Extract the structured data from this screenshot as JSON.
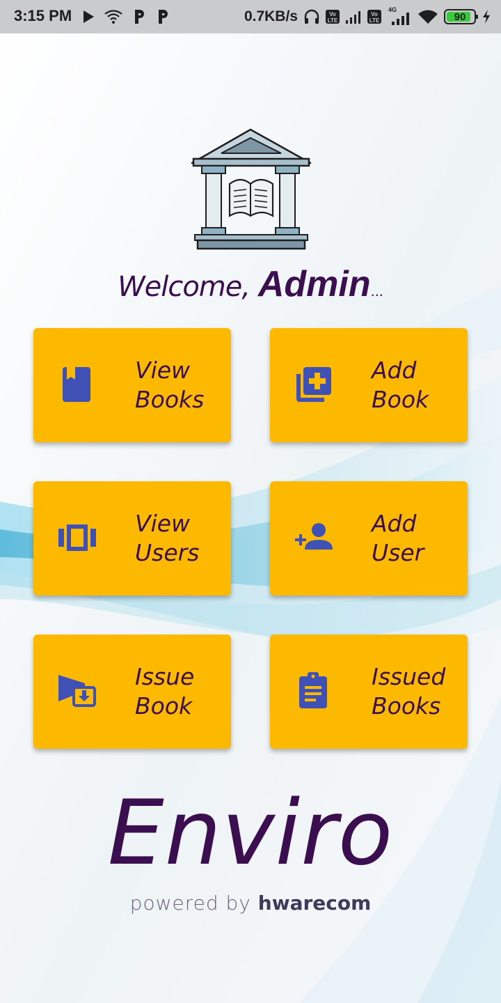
{
  "status_bar": {
    "time": "3:15 PM",
    "net_speed": "0.7KB/s",
    "lte1": "Vo LTE",
    "lte2": "Vo LTE",
    "network_type": "4G",
    "battery_level": "90",
    "battery_fraction": 0.9,
    "icons": [
      "play-icon",
      "wifi-icon",
      "p-icon",
      "p-icon",
      "headphones-icon",
      "signal-icon",
      "signal-icon",
      "wifi-icon",
      "battery-icon",
      "charging-icon"
    ]
  },
  "header": {
    "logo": "library-building-icon",
    "welcome_prefix": "Welcome, ",
    "welcome_name": "Admin",
    "welcome_suffix": "..."
  },
  "menu": {
    "accent_color": "#fcb900",
    "icon_color": "#3f51b5",
    "text_color": "#3b0f4f",
    "items": [
      {
        "line1": "View",
        "line2": "Books",
        "icon": "book-icon"
      },
      {
        "line1": "Add",
        "line2": "Book",
        "icon": "library-add-icon"
      },
      {
        "line1": "View",
        "line2": "Users",
        "icon": "view-carousel-icon"
      },
      {
        "line1": "Add",
        "line2": "User",
        "icon": "person-add-icon"
      },
      {
        "line1": "Issue",
        "line2": "Book",
        "icon": "issue-book-icon"
      },
      {
        "line1": "Issued",
        "line2": "Books",
        "icon": "assignment-icon"
      }
    ]
  },
  "footer": {
    "brand": "Enviro",
    "powered_prefix": "powered by ",
    "powered_company": "hwarecom"
  }
}
